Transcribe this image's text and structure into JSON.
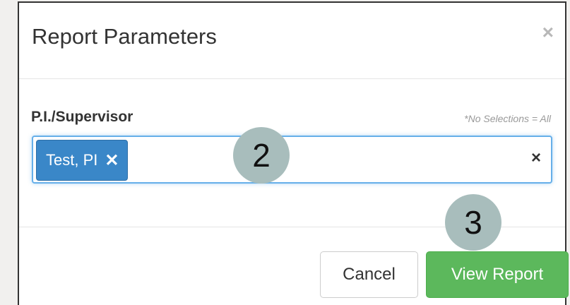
{
  "modal": {
    "title": "Report Parameters",
    "close_label": "×"
  },
  "field": {
    "label": "P.I./Supervisor",
    "hint": "*No Selections = All",
    "selected_tags": [
      {
        "label": "Test, PI",
        "remove_label": "✕"
      }
    ],
    "clear_label": "×"
  },
  "annotations": {
    "step_2": "2",
    "step_3": "3"
  },
  "buttons": {
    "cancel": "Cancel",
    "view_report": "View Report"
  },
  "colors": {
    "tag_bg": "#3a87c8",
    "primary_button": "#5cb85c",
    "focus_border": "#66afe9",
    "annotation_circle": "#a8bdbc"
  }
}
